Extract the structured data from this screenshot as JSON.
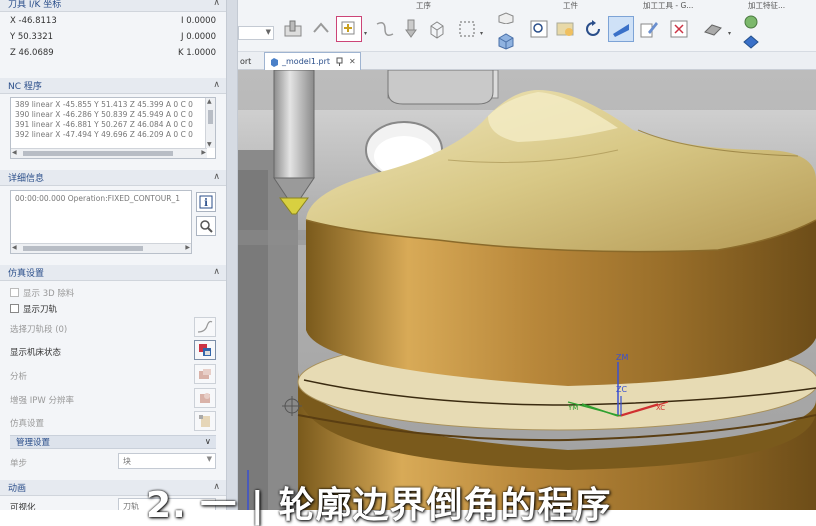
{
  "tool_coords": {
    "title": "刀具 I/K 坐标",
    "x": "X -46.8113",
    "i": "I 0.0000",
    "y": "Y 50.3321",
    "j": "J 0.0000",
    "z": "Z 46.0689",
    "k": "K 1.0000"
  },
  "nc_program": {
    "title": "NC 程序",
    "lines": [
      "389 linear X -45.855 Y 51.413 Z 45.399 A 0 C 0",
      "390 linear X -46.286 Y 50.839 Z 45.949 A 0 C 0",
      "391 linear X -46.881 Y 50.267 Z 46.084 A 0 C 0",
      "392 linear X -47.494 Y 49.696 Z 46.209 A 0 C 0"
    ]
  },
  "details": {
    "title": "详细信息",
    "text": "00:00:00.000 Operation:FIXED_CONTOUR_1"
  },
  "sim_settings": {
    "title": "仿真设置",
    "show_3d_removal": "显示 3D 除料",
    "show_toolpath": "显示刀轨",
    "select_toolpath": "选择刀轨段 (0)",
    "show_machine_state": "显示机床状态",
    "analysis": "分析",
    "ipw_resolution": "增强 IPW 分辨率",
    "sim_settings_row": "仿真设置",
    "manage_settings": "管理设置",
    "step_label": "单步",
    "step_value": "块"
  },
  "animation": {
    "title": "动画",
    "visualize_label": "可视化",
    "visualize_value": "刀轨"
  },
  "toolbar": {
    "group_process": "工序",
    "group_workpiece": "工件",
    "group_tools": "加工工具 - G...",
    "group_features": "加工特征..."
  },
  "tabs": {
    "part_label": "ort",
    "model_label": "_model1.prt"
  },
  "axes": {
    "zm": "ZM",
    "zc": "ZC",
    "xc": "XC",
    "ym": "YM"
  },
  "subtitle": "2. 一 | 轮廓边界倒角的程序"
}
